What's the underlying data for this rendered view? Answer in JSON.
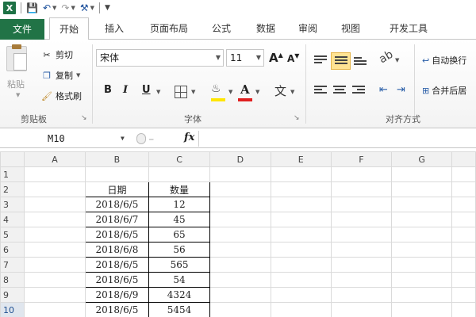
{
  "qat": {
    "app_icon": "X",
    "save_icon": "save-icon",
    "undo_icon": "undo-icon",
    "redo_icon": "redo-icon",
    "customize_icon": "customize-qat-icon"
  },
  "tabs": [
    "文件",
    "开始",
    "插入",
    "页面布局",
    "公式",
    "数据",
    "审阅",
    "视图",
    "开发工具"
  ],
  "active_tab": "开始",
  "ribbon": {
    "clipboard": {
      "paste": "粘贴",
      "cut": "剪切",
      "copy": "复制",
      "format_painter": "格式刷",
      "group": "剪贴板"
    },
    "font": {
      "name": "宋体",
      "size": "11",
      "bold": "B",
      "italic": "I",
      "underline": "U",
      "grow": "A",
      "shrink": "A",
      "phonetic": "文",
      "group": "字体"
    },
    "alignment": {
      "wrap": "自动换行",
      "merge": "合并后居",
      "group": "对齐方式"
    }
  },
  "formula_bar": {
    "name_box": "M10",
    "fx": "fx",
    "value": ""
  },
  "columns": [
    "A",
    "B",
    "C",
    "D",
    "E",
    "F",
    "G"
  ],
  "rows": [
    "1",
    "2",
    "3",
    "4",
    "5",
    "6",
    "7",
    "8",
    "9",
    "10"
  ],
  "selected_row": "10",
  "table": {
    "header": {
      "date": "日期",
      "qty": "数量"
    },
    "rows": [
      [
        "2018/6/5",
        "12"
      ],
      [
        "2018/6/7",
        "45"
      ],
      [
        "2018/6/5",
        "65"
      ],
      [
        "2018/6/8",
        "56"
      ],
      [
        "2018/6/5",
        "565"
      ],
      [
        "2018/6/5",
        "54"
      ],
      [
        "2018/6/9",
        "4324"
      ],
      [
        "2018/6/5",
        "5454"
      ]
    ]
  },
  "colors": {
    "file_tab": "#217346",
    "active_align": "#ffe393",
    "font_color_red": "#e02020",
    "fill_yellow": "#ffe600"
  }
}
